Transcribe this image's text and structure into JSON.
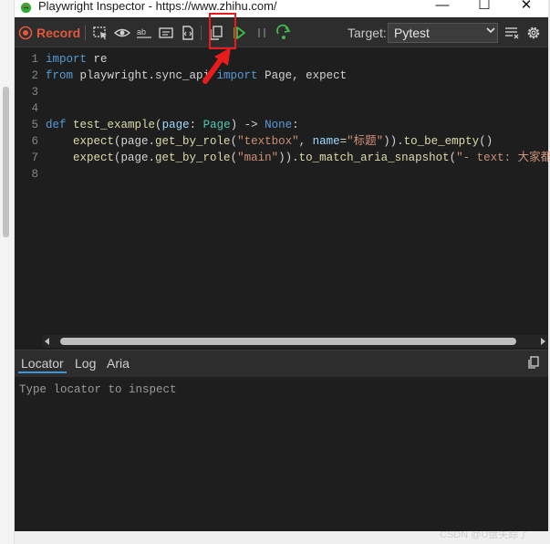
{
  "window": {
    "title": "Playwright Inspector - https://www.zhihu.com/",
    "minimize_glyph": "—",
    "maximize_glyph": "☐",
    "close_glyph": "✕"
  },
  "toolbar": {
    "record_label": "Record",
    "icons": [
      "record-icon",
      "pick-locator-icon",
      "assert-visibility-icon",
      "assert-text-icon",
      "assert-value-icon",
      "assert-snapshot-icon",
      "copy-icon",
      "resume-icon",
      "pause-icon",
      "step-over-icon",
      "clear-icon",
      "settings-icon"
    ],
    "target_label": "Target:",
    "target_value": "Pytest"
  },
  "editor": {
    "line_numbers": [
      "1",
      "2",
      "3",
      "4",
      "5",
      "6",
      "7",
      "8"
    ]
  },
  "bottom_panel": {
    "tabs": [
      "Locator",
      "Log",
      "Aria"
    ],
    "locator_placeholder": "Type locator to inspect"
  },
  "watermark": "CSDN @U盘失踪了",
  "colors": {
    "accent_red": "#e81c1c",
    "record_red": "#e2583e",
    "resume_green": "#3fb950",
    "tab_underline": "#3c97d8"
  }
}
